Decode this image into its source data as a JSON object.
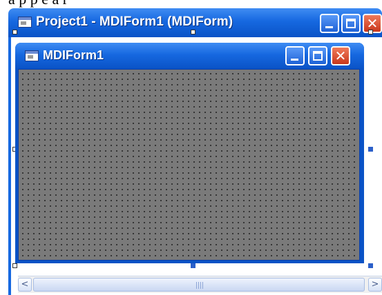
{
  "top_text": "a p p e a r",
  "outer_window": {
    "title": "Project1 - MDIForm1 (MDIForm)",
    "icon": "app-form-icon",
    "buttons": {
      "minimize": "minimize-icon",
      "maximize": "maximize-icon",
      "close_glyph": "✕"
    }
  },
  "mdi_window": {
    "title": "MDIForm1",
    "icon": "app-form-icon",
    "buttons": {
      "minimize": "minimize-icon",
      "maximize": "maximize-icon",
      "close_glyph": "✕"
    }
  },
  "hscroll": {
    "left_glyph": "<",
    "right_glyph": ">"
  },
  "colors": {
    "titlebar_blue": "#1668e0",
    "close_red": "#c9371a",
    "client_grey": "#7a7a7a"
  }
}
